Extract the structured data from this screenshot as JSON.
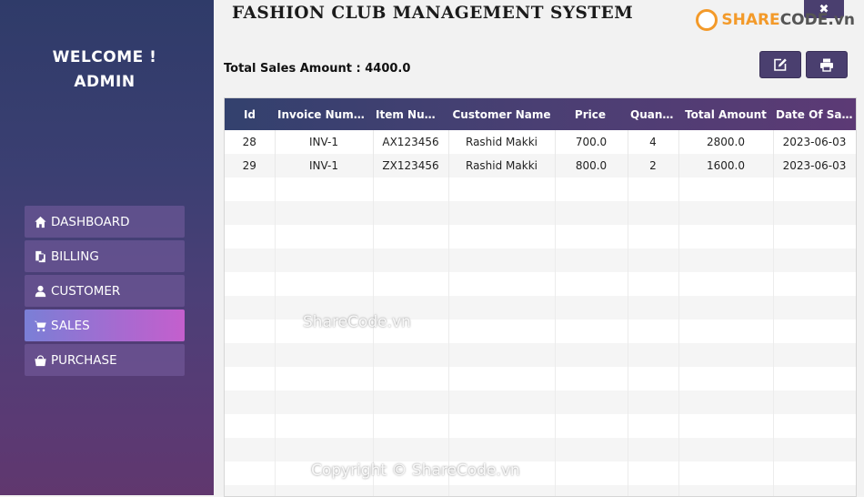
{
  "sidebar": {
    "welcome_line1": "WELCOME !",
    "welcome_line2": "ADMIN",
    "items": [
      {
        "label": "DASHBOARD",
        "icon": "home-icon"
      },
      {
        "label": "BILLING",
        "icon": "copy-icon"
      },
      {
        "label": "CUSTOMER",
        "icon": "user-icon"
      },
      {
        "label": "SALES",
        "icon": "cart-icon"
      },
      {
        "label": "PURCHASE",
        "icon": "bag-icon"
      }
    ],
    "active": "SALES"
  },
  "header": {
    "title": "FASHION CLUB MANAGEMENT SYSTEM",
    "close_label": "✖"
  },
  "summary": {
    "label": "Total Sales Amount :",
    "value": "4400.0"
  },
  "toolbar": {
    "edit_icon": "edit-icon",
    "print_icon": "print-icon"
  },
  "table": {
    "columns": [
      "Id",
      "Invoice Number",
      "Item Number",
      "Customer Name",
      "Price",
      "Quant...",
      "Total Amount",
      "Date Of Sales"
    ],
    "rows": [
      [
        "28",
        "INV-1",
        "AX123456",
        "Rashid Makki",
        "700.0",
        "4",
        "2800.0",
        "2023-06-03"
      ],
      [
        "29",
        "INV-1",
        "ZX123456",
        "Rashid Makki",
        "800.0",
        "2",
        "1600.0",
        "2023-06-03"
      ]
    ]
  },
  "watermarks": {
    "logo_share": "SHARE",
    "logo_code": "CODE",
    "logo_vn": ".vn",
    "center": "ShareCode.vn",
    "bottom": "Copyright © ShareCode.vn"
  },
  "colors": {
    "accent": "#4a3f6f",
    "active_nav_start": "#7a7fd6",
    "active_nav_end": "#c45fcd",
    "logo_orange": "#f39a2a"
  }
}
